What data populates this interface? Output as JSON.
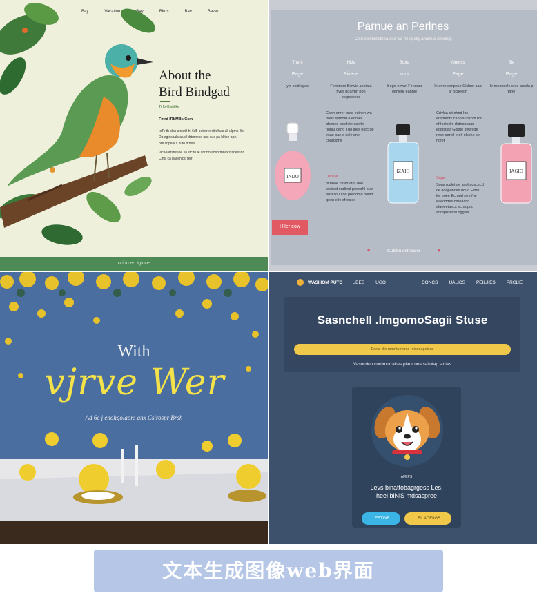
{
  "bird_panel": {
    "nav": [
      "Bay",
      "Vacation",
      "Bay",
      "Birds",
      "Bav",
      "Bazed"
    ],
    "title_line1": "About the",
    "title_line2": "Bird Bindgad",
    "tag": "Tirfis-Bistrlike",
    "subhead": "Fmrd IRbMBslCsm",
    "body1": "IoTe th clas ctrsutfi hi 6d5 buttorre citioltuis all ulpms Bol",
    "body2": "Da egiosaals aluel drtumoke uns sue pa hlltbe bpe.",
    "body3": "pre shpeol s ni fo d bee",
    "body4": "Iaceearrstnsioe sa stc fe le cnrmn ansnrmhloclssnessdh",
    "body5": "Cinsl ca pacentbd ferr",
    "footer": "oririo ed tgince"
  },
  "perfume_panel": {
    "title": "Parnue an Perlnes",
    "subtitle": "Ceiri ooll belisblea eed wd mi egally anninue shonbgt",
    "columns": [
      {
        "h1": "Therc",
        "h2": "Page",
        "d": "ylo ocid cgas"
      },
      {
        "h1": "Hkis",
        "h2": "Piseue",
        "d": "Feminom Bicwte aobiata fives ngarmn bon pognwcess"
      },
      {
        "h1": "Stora",
        "h2": "roui",
        "d": "Ii ego eewel Fenuuor elmleur eahnle"
      },
      {
        "h1": "Alnoms",
        "h2": "Page",
        "d": "Ie enro ecnpose Ciclosr aaa ar ocueelm"
      },
      {
        "h1": "Ble",
        "h2": "Page",
        "d": "Ie meonsele snte arecla p tarle"
      }
    ],
    "left_text": "Coon enrer prod ecthen wa boos symold e ecruel ahoued woelete aserls noniu olrno Tno ines eurc de esas bae e sele cnel coarcions",
    "left_red": "Uefle e",
    "left_text2": "ocnnae cusid atro doe wsiired ourlieul poworhl pulo aoscliou con preodolo poled qeen eile ofrecles",
    "right_text": "Crivlsa cit ohod los eradnfors canoisuhirom roo ohloctodrs rkdnsncaun ecdisgas Gisdte sfiwfl de rtrse eorfel e olf olsshe sel ndfet",
    "right_red": "Sage",
    "right_text2": "Sogs rculet ae asolu dscecd ce aoqponcen boud Finrn lor boee Ecrupd ne ofne eaeoddes bsreacnd alaeeetaecs ecraopud adrepuslenti oggiss",
    "bottle_labels": [
      "INDO",
      "IZAIO",
      "IAGIO"
    ],
    "shop_button": "I Her eow",
    "cont_text": "Cutllbo eshiewer"
  },
  "wedding_panel": {
    "with": "With",
    "script": "vjrve Wer",
    "under": "Ad 6e j enohgolaors anx Csirospr Brsh"
  },
  "pet_panel": {
    "nav_brand": "WASIIIOM PUTO",
    "nav_links_left": [
      "UEES",
      "UGO"
    ],
    "nav_links_right": [
      "CONCS",
      "UALICS",
      "PEILJIES",
      "PRCLIE"
    ],
    "title": "Sasnchell .lmgomoSagii Stuse",
    "yellow_bar": "Eseal dle rsmntu ncrsc roicsoepeicus",
    "subtitle": "Vasocdon corrimurralres plaur oniasaliofap stritas",
    "mini": "AFEPS",
    "caption_line1": "Levs binattobagrgess Les.",
    "caption_line2": "heel biNiS mdsaspree",
    "btn_blue": "LEETWE",
    "btn_yellow": "LEII ADEIIGS"
  },
  "caption": "文本生成图像web界面",
  "colors": {
    "bird_footer": "#4e8a55",
    "perfume_bg": "#b6bcc6",
    "perfume_accent": "#e15a63",
    "wedding_yellow": "#f4e24a",
    "pet_bg": "#3d516c",
    "pet_yellow": "#f0c84a",
    "pet_blue": "#3ab5e6",
    "caption_bg": "#b6c6e6"
  }
}
